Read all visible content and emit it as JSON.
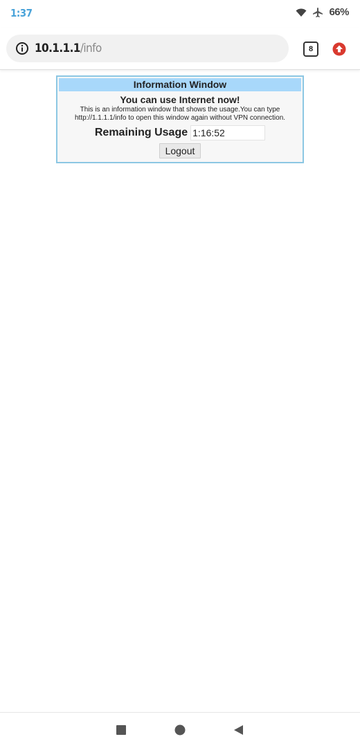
{
  "status_bar": {
    "time": "1:37",
    "battery": "66%",
    "icons": [
      "wifi-icon",
      "airplane-icon"
    ]
  },
  "browser": {
    "url_host": "10.1.1.1",
    "url_path": "/info",
    "tab_count": "8",
    "icons": [
      "info-icon",
      "tabs-icon",
      "update-icon"
    ],
    "colors": {
      "update_icon": "#d93a2f",
      "status_time": "#4aa3d9"
    }
  },
  "info_window": {
    "title": "Information Window",
    "heading": "You can use Internet now!",
    "description": "This is an information window that shows the usage.You can type http://1.1.1.1/info to open this window again without VPN connection.",
    "usage_label": "Remaining Usage",
    "usage_value": "1:16:52",
    "logout_label": "Logout",
    "colors": {
      "title_bg": "#a8d8fa",
      "border": "#8cc7e3"
    }
  },
  "nav_bar": {
    "icons": [
      "recents-square-icon",
      "home-circle-icon",
      "back-triangle-icon"
    ]
  }
}
